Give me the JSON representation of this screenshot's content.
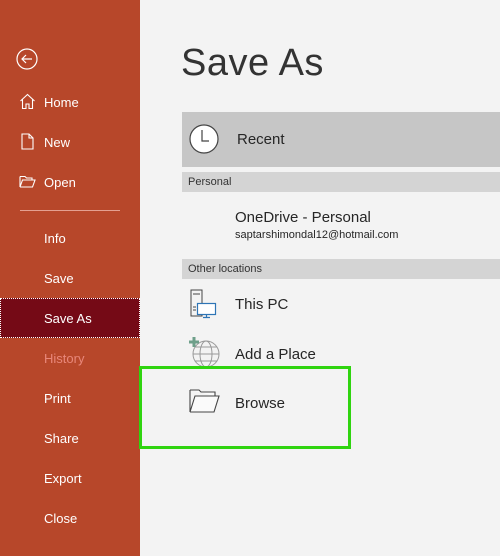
{
  "sidebar": {
    "back_label": "Back",
    "items": [
      {
        "label": "Home",
        "icon": "home-icon"
      },
      {
        "label": "New",
        "icon": "new-document-icon"
      },
      {
        "label": "Open",
        "icon": "open-folder-icon"
      },
      {
        "label": "Info"
      },
      {
        "label": "Save"
      },
      {
        "label": "Save As",
        "active": true
      },
      {
        "label": "History",
        "disabled": true
      },
      {
        "label": "Print"
      },
      {
        "label": "Share"
      },
      {
        "label": "Export"
      },
      {
        "label": "Close"
      }
    ]
  },
  "main": {
    "title": "Save As",
    "recent": {
      "label": "Recent",
      "icon": "clock-icon"
    },
    "sections": [
      {
        "header": "Personal",
        "items": [
          {
            "label": "OneDrive - Personal",
            "sublabel": "saptarshimondal12@hotmail.com"
          }
        ]
      },
      {
        "header": "Other locations",
        "items": [
          {
            "label": "This PC",
            "icon": "computer-icon"
          },
          {
            "label": "Add a Place",
            "icon": "add-place-globe-icon"
          },
          {
            "label": "Browse",
            "icon": "browse-folder-icon",
            "highlighted": true
          }
        ]
      }
    ]
  },
  "colors": {
    "sidebar_bg": "#b7472a",
    "active_item_bg": "#750a16",
    "highlight_box": "#2fd40f",
    "content_bg": "#f3f3f3"
  }
}
